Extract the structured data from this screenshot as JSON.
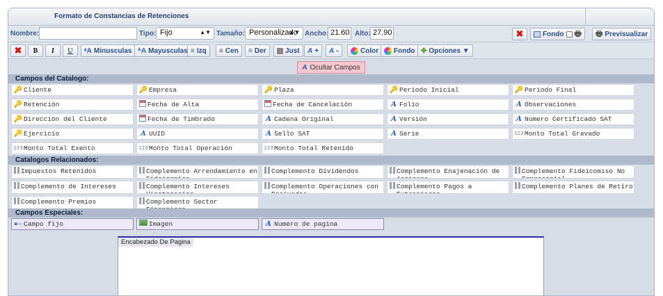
{
  "window": {
    "title": "Formato de Constancias de Retenciones"
  },
  "form": {
    "nombre_label": "Nombre:",
    "nombre_value": "",
    "tipo_label": "Tipo:",
    "tipo_value": "Fijo",
    "tamano_label": "Tamaño:",
    "tamano_value": "Personalizado",
    "ancho_label": "Ancho:",
    "ancho_value": "21.60",
    "alto_label": "Alto:",
    "alto_value": "27.90",
    "fondo_label": "Fondo",
    "previsualizar_label": "Previsualizar"
  },
  "toolbar": {
    "bold": "B",
    "italic": "I",
    "underline": "U",
    "minusculas": "Minusculas",
    "mayusculas": "Mayusculas",
    "izq": "Izq",
    "cen": "Cen",
    "der": "Der",
    "just": "Just",
    "font_plus": "+",
    "font_minus": "-",
    "color": "Color",
    "fondo": "Fondo",
    "opciones": "Opciones ▼"
  },
  "ocultar_campos": "Ocultar Campos",
  "sections": {
    "catalogo": "Campos del Catalogo:",
    "relacionados": "Catalogos Relacionados:",
    "especiales": "Campos Especiales:"
  },
  "catalog_fields": [
    {
      "label": "Cliente",
      "icon": "key-icon"
    },
    {
      "label": "Empresa",
      "icon": "key-icon"
    },
    {
      "label": "Plaza",
      "icon": "key-icon"
    },
    {
      "label": "Periodo Inicial",
      "icon": "key-icon"
    },
    {
      "label": "Periodo Final",
      "icon": "key-icon"
    },
    {
      "label": "Retención",
      "icon": "key-icon"
    },
    {
      "label": "Fecha de Alta",
      "icon": "calendar-icon"
    },
    {
      "label": "Fecha de Cancelación",
      "icon": "calendar-icon"
    },
    {
      "label": "Folio",
      "icon": "text-icon"
    },
    {
      "label": "Observaciones",
      "icon": "text-icon"
    },
    {
      "label": "Dirección del Cliente",
      "icon": "key-icon"
    },
    {
      "label": "Fecha de Timbrado",
      "icon": "calendar-icon"
    },
    {
      "label": "Cadena Original",
      "icon": "text-icon"
    },
    {
      "label": "Versión",
      "icon": "text-icon"
    },
    {
      "label": "Número Certificado SAT",
      "icon": "text-icon"
    },
    {
      "label": "Ejercicio",
      "icon": "key-icon"
    },
    {
      "label": "UUID",
      "icon": "text-icon"
    },
    {
      "label": "Sello SAT",
      "icon": "text-icon"
    },
    {
      "label": "Serie",
      "icon": "text-icon"
    },
    {
      "label": "Monto Total Gravado",
      "icon": "number-icon"
    },
    {
      "label": "Monto Total Exento",
      "icon": "number-icon"
    },
    {
      "label": "Monto Total Operación",
      "icon": "number-icon"
    },
    {
      "label": "Monto Total Retenido",
      "icon": "number-icon"
    }
  ],
  "related_catalogs": [
    "Impuestos Retenidos",
    "Complemento Arrendamiento en Fideicomiso",
    "Complemento Dividendos",
    "Complemento Enajenación de Acciones",
    "Complemento Fideicomiso No Empresarial",
    "Complemento de Intereses",
    "Complemento Intereses Hipotecarios",
    "Complemento Operaciones con Derivados",
    "Complemento Pagos a Extranjeros",
    "Complemento Planes de Retiro",
    "Complemento Premios",
    "Complemento Sector Financiero"
  ],
  "special_fields": [
    {
      "label": "Campo fijo",
      "icon": "fixed-field-icon"
    },
    {
      "label": "Imagen",
      "icon": "image-icon"
    },
    {
      "label": "Numero de pagina",
      "icon": "text-icon"
    }
  ],
  "editor": {
    "header_label": "Encabezado De Pagina"
  }
}
